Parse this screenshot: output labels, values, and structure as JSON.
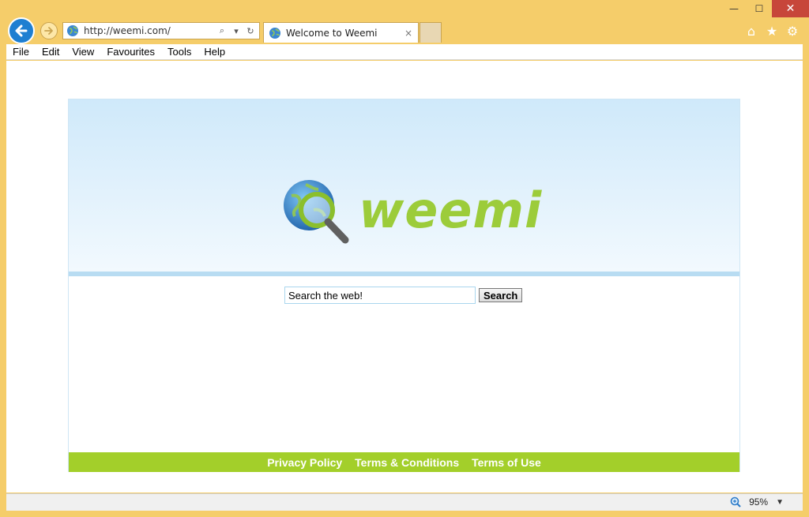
{
  "window": {
    "minimize": "—",
    "maximize": "☐",
    "close": "✕"
  },
  "navigation": {
    "url": "http://weemi.com/",
    "search_icon": "⌕",
    "dropdown_icon": "▾",
    "refresh_icon": "↻"
  },
  "tab": {
    "title": "Welcome to Weemi",
    "close": "×"
  },
  "toolbar_icons": {
    "home": "⌂",
    "favorites": "★",
    "settings": "⚙"
  },
  "menu": {
    "items": [
      "File",
      "Edit",
      "View",
      "Favourites",
      "Tools",
      "Help"
    ]
  },
  "page": {
    "logo_text": "weemi",
    "search_value": "Search the web!",
    "search_button": "Search",
    "footer_links": [
      "Privacy Policy",
      "Terms & Conditions",
      "Terms of Use"
    ]
  },
  "status": {
    "zoom": "95%",
    "zoom_dropdown": "▼"
  },
  "colors": {
    "frame": "#f5cd6a",
    "accent_green": "#a3cf2a",
    "logo_green": "#9ccc3a",
    "back_button_blue": "#1e7fd1",
    "hero_blue": "#cfe9fa"
  }
}
